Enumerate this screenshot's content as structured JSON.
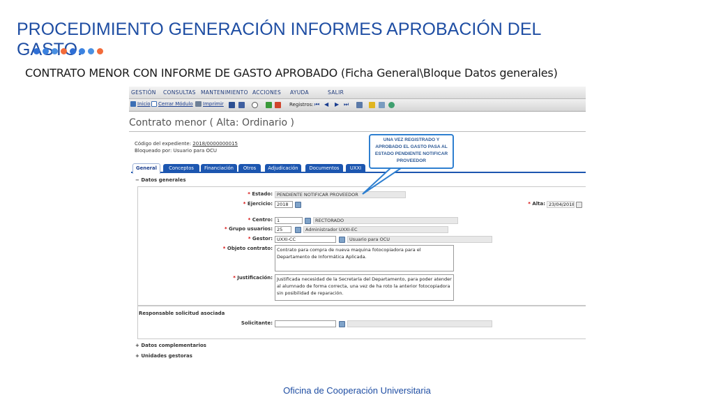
{
  "slide": {
    "title": "PROCEDIMIENTO GENERACIÓN INFORMES APROBACIÓN DEL GASTO.",
    "subtitle": "CONTRATO MENOR CON INFORME DE GASTO APROBADO (Ficha General\\Bloque Datos generales)",
    "footer": "Oficina de Cooperación Universitaria",
    "dot_colors": [
      "#2f6fd6",
      "#3b82e0",
      "#4a90e2",
      "#f26b3a",
      "#2f6fd6",
      "#3b82e0",
      "#4a90e2",
      "#f26b3a"
    ]
  },
  "app": {
    "menu": [
      "GESTIÓN",
      "CONSULTAS",
      "MANTENIMIENTO",
      "ACCIONES",
      "AYUDA",
      "SALIR"
    ],
    "toolbar": {
      "inicio": "Inicio",
      "cerrar": "Cerrar Módulo",
      "imprimir": "Imprimir",
      "registros": "Registros:"
    },
    "form_title": "Contrato menor ( Alta: Ordinario )",
    "codigo_label": "Código del expediente:",
    "codigo_value": "2018/0000000015",
    "bloqueado": "Bloqueado por: Usuario para OCU",
    "tabs": [
      "General",
      "Conceptos",
      "Financiación",
      "Otros",
      "Adjudicación",
      "Documentos",
      "UXXI"
    ],
    "datos_generales": "Datos generales",
    "fields": {
      "estado_label": "Estado:",
      "estado_value": "PENDIENTE NOTIFICAR PROVEEDOR",
      "ejercicio_label": "Ejercicio:",
      "ejercicio_value": "2018",
      "alta_label": "Alta:",
      "alta_value": "23/04/2018",
      "centro_label": "Centro:",
      "centro_value": "1",
      "centro_desc": "RECTORADO",
      "grupo_label": "Grupo usuarios:",
      "grupo_value": "25",
      "grupo_desc": "Administrador UXXI-EC",
      "gestor_label": "Gestor:",
      "gestor_value": "UXXI-CC",
      "gestor_desc": "Usuario para OCU",
      "objeto_label": "Objeto contrato:",
      "objeto_value": "Contrato para compra de nueva maquina fotocopiadora para el Departamento de Informática Aplicada.",
      "justificacion_label": "Justificación:",
      "justificacion_value": "Justificada necesidad de la Secretaría del Departamento, para poder atender al alumnado de forma correcta, una vez de ha roto la anterior fotocopiadora sin posibilidad de reparación."
    },
    "responsable": "Responsable solicitud asociada",
    "solicitante_label": "Solicitante:",
    "datos_complementarios": "Datos complementarios",
    "unidades_gestoras": "Unidades gestoras",
    "callout": "UNA VEZ REGISTRADO Y APROBADO EL GASTO PASA AL ESTADO PENDIENTE NOTIFICAR PROVEEDOR"
  }
}
